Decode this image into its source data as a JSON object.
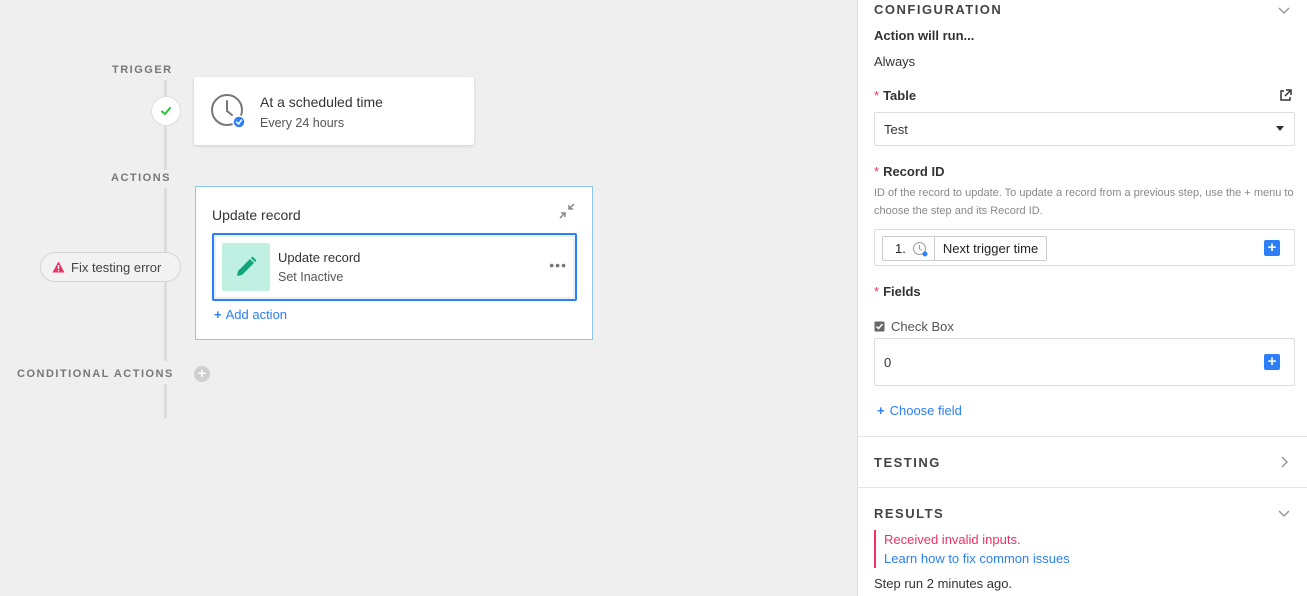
{
  "canvas": {
    "trigger_label": "TRIGGER",
    "actions_label": "ACTIONS",
    "conditional_label": "CONDITIONAL ACTIONS",
    "trigger": {
      "title": "At a scheduled time",
      "subtitle": "Every 24 hours",
      "icon": "clock-icon"
    },
    "action_group": {
      "title": "Update record",
      "step": {
        "title": "Update record",
        "subtitle": "Set Inactive",
        "more": "•••",
        "icon": "pencil-icon"
      },
      "add_action": "Add action"
    },
    "fix_error": "Fix testing error",
    "add_conditional": "+"
  },
  "panel": {
    "configuration": {
      "header": "CONFIGURATION",
      "run_label": "Action will run...",
      "run_value": "Always",
      "table_label": "Table",
      "table_value": "Test",
      "record_id_label": "Record ID",
      "record_id_hint": "ID of the record to update. To update a record from a previous step, use the + menu to choose the step and its Record ID.",
      "token_num": "1.",
      "token_name": "Next trigger time",
      "fields_label": "Fields",
      "field_name": "Check Box",
      "field_value": "0",
      "choose_field": "Choose field",
      "plus": "+"
    },
    "testing": {
      "header": "TESTING"
    },
    "results": {
      "header": "RESULTS",
      "error": "Received invalid inputs.",
      "link": "Learn how to fix common issues",
      "step_run": "Step run 2 minutes ago."
    },
    "colors": {
      "accent": "#2d7ff9",
      "error": "#ef3061",
      "success": "#20c933",
      "step_bg": "#bff0e2"
    }
  }
}
